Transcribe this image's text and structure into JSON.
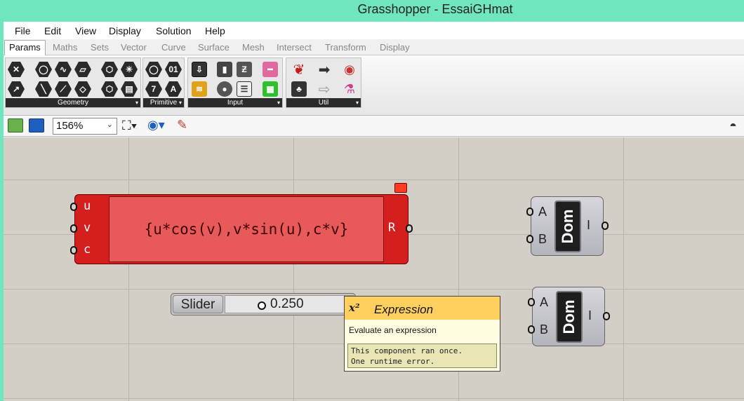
{
  "window": {
    "title": "Grasshopper - EssaiGHmat"
  },
  "menu": [
    "File",
    "Edit",
    "View",
    "Display",
    "Solution",
    "Help"
  ],
  "tabs": [
    "Params",
    "Maths",
    "Sets",
    "Vector",
    "Curve",
    "Surface",
    "Mesh",
    "Intersect",
    "Transform",
    "Display"
  ],
  "active_tab": "Params",
  "ribbon": {
    "panels": [
      {
        "label": "Geometry"
      },
      {
        "label": "Primitive"
      },
      {
        "label": "Input"
      },
      {
        "label": "Util"
      }
    ],
    "icons": {
      "geometry_row1": [
        "point-param-icon",
        "circle-param-icon",
        "curve-param-icon",
        "surface-param-icon",
        "box-param-icon",
        "mesh-param-icon"
      ],
      "geometry_row2": [
        "vector-param-icon",
        "line-param-icon",
        "brep-param-icon",
        "plane-param-icon",
        "geometry-param-icon",
        "field-param-icon"
      ],
      "primitive_row1": [
        "domain-param-icon",
        "binary-param-icon"
      ],
      "primitive_row2_text": [
        "7",
        "A"
      ],
      "input_row1": [
        "panel-param-icon",
        "toggle-param-icon",
        "digit-scroller-icon",
        "slider-param-icon"
      ],
      "input_row2": [
        "graph-mapper-icon",
        "color-picker-icon",
        "value-list-icon",
        "pixel-grid-icon"
      ],
      "util_row1": [
        "cherry-picker-icon",
        "arrow-icon",
        "fruit-icon"
      ],
      "util_row2": [
        "tree-icon",
        "hollow-arrow-icon",
        "flask-icon"
      ]
    },
    "primitive_labels": {
      "binary": "01",
      "integer": "7",
      "text": "A"
    }
  },
  "toolbar": {
    "zoom": "156%"
  },
  "canvas": {
    "expression": {
      "formula": "{u*cos(v),v*sin(u),c*v}",
      "inputs": [
        "u",
        "v",
        "c"
      ],
      "output": "R"
    },
    "domains": [
      {
        "label": "Dom",
        "a": "A",
        "b": "B",
        "out": "I"
      },
      {
        "label": "Dom",
        "a": "A",
        "b": "B",
        "out": "I"
      }
    ],
    "slider": {
      "name": "Slider",
      "value": "0.250"
    },
    "tooltip": {
      "icon_text": "x²",
      "title": "Expression",
      "description": "Evaluate an expression",
      "message_line1": "This component ran once.",
      "message_line2": "One runtime error."
    }
  }
}
